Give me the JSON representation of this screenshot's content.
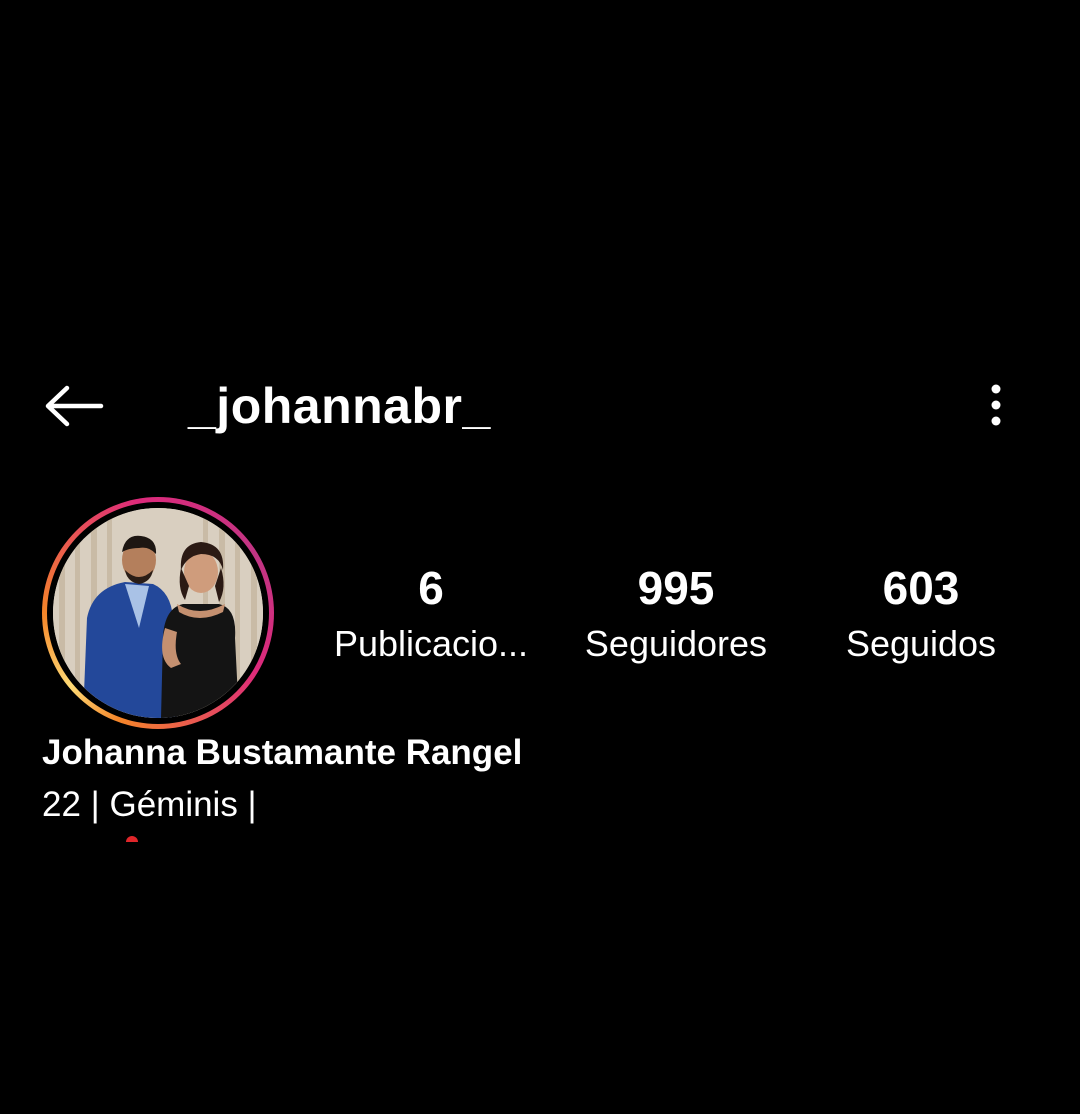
{
  "header": {
    "back_icon": "arrow-left-icon",
    "username": "_johannabr_",
    "more_icon": "more-vertical-icon"
  },
  "profile": {
    "avatar_alt": "profile-photo",
    "story_ring_colors": [
      "#f58529",
      "#feda75",
      "#dd2a7b",
      "#c13584"
    ]
  },
  "stats": {
    "posts": {
      "count": "6",
      "label": "Publicacio..."
    },
    "followers": {
      "count": "995",
      "label": "Seguidores"
    },
    "following": {
      "count": "603",
      "label": "Seguidos"
    }
  },
  "bio": {
    "full_name": "Johanna Bustamante Rangel",
    "line1": "22 | Géminis |"
  },
  "colors": {
    "background": "#000000",
    "text": "#ffffff"
  }
}
